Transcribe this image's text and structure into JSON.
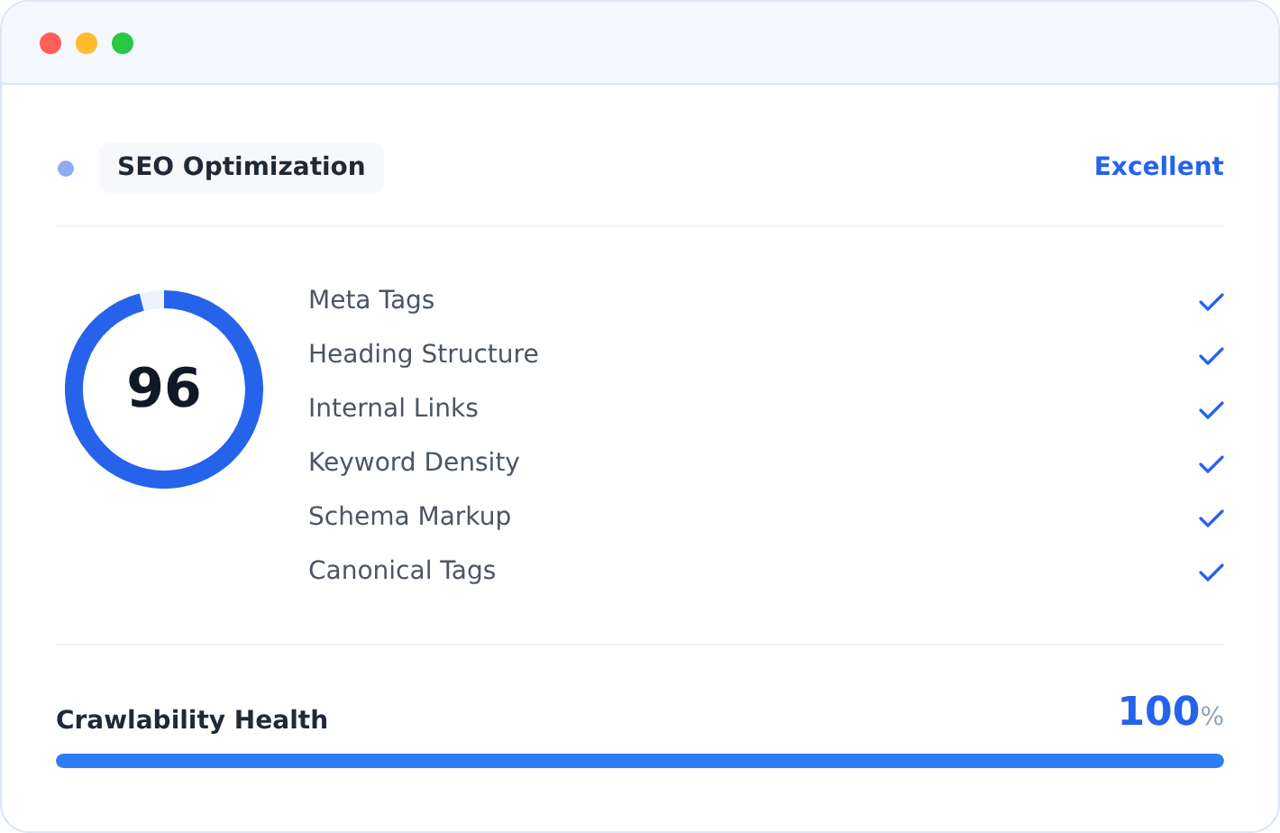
{
  "window": {
    "controls": [
      {
        "color": "#ff5f57"
      },
      {
        "color": "#febc2e"
      },
      {
        "color": "#28c840"
      }
    ]
  },
  "header": {
    "title": "SEO Optimization",
    "status": "Excellent"
  },
  "score": {
    "value": "96",
    "level": 0.96
  },
  "checks": [
    {
      "label": "Meta Tags",
      "checked": true
    },
    {
      "label": "Heading Structure",
      "checked": true
    },
    {
      "label": "Internal Links",
      "checked": true
    },
    {
      "label": "Keyword Density",
      "checked": true
    },
    {
      "label": "Schema Markup",
      "checked": true
    },
    {
      "label": "Canonical Tags",
      "checked": true
    }
  ],
  "health": {
    "label": "Crawlability Health",
    "value": "100",
    "unit": "%",
    "level": 1
  }
}
